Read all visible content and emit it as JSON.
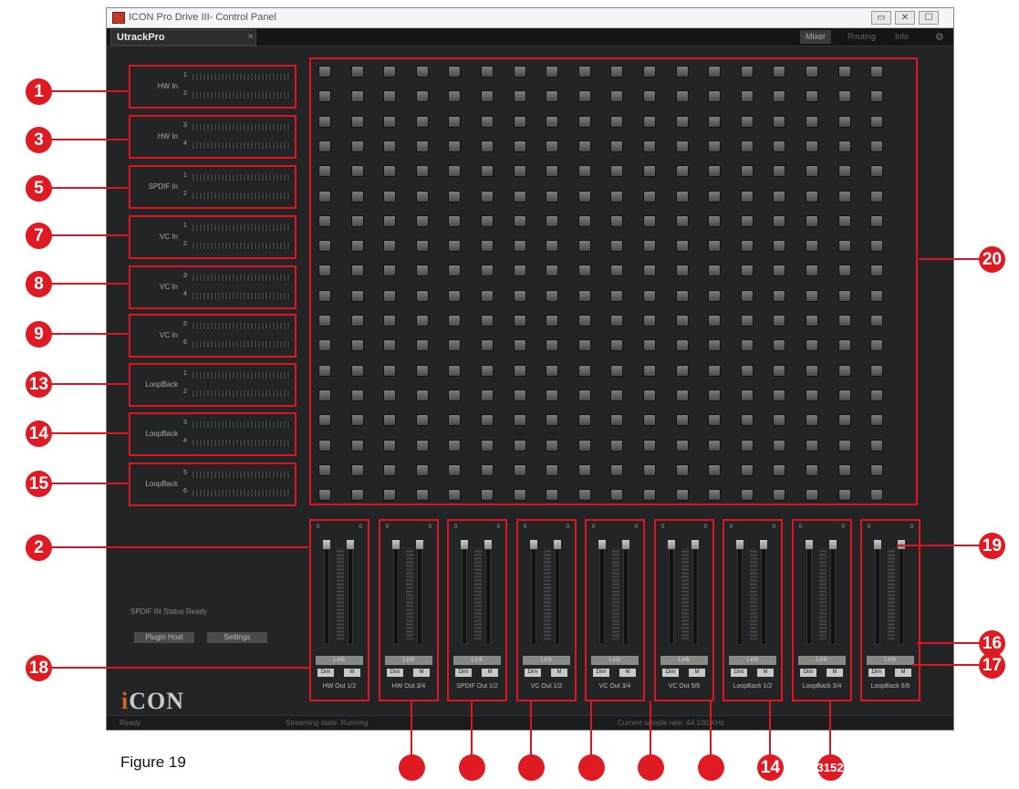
{
  "window": {
    "title": "ICON Pro Drive III- Control Panel",
    "device_tab": "UtrackPro",
    "nav_tabs": [
      "Mixer",
      "Routing",
      "Info"
    ],
    "active_nav": 0,
    "controls": [
      "▭",
      "✕",
      "☐"
    ],
    "gear": "⚙"
  },
  "inputs": [
    {
      "name": "HW In",
      "ch": [
        "1",
        "2"
      ]
    },
    {
      "name": "HW In",
      "ch": [
        "3",
        "4"
      ]
    },
    {
      "name": "SPDIF In",
      "ch": [
        "1",
        "2"
      ]
    },
    {
      "name": "VC In",
      "ch": [
        "1",
        "2"
      ]
    },
    {
      "name": "VC In",
      "ch": [
        "3",
        "4"
      ]
    },
    {
      "name": "VC In",
      "ch": [
        "5",
        "6"
      ]
    },
    {
      "name": "LoopBack",
      "ch": [
        "1",
        "2"
      ]
    },
    {
      "name": "LoopBack",
      "ch": [
        "3",
        "4"
      ]
    },
    {
      "name": "LoopBack",
      "ch": [
        "5",
        "6"
      ]
    }
  ],
  "matrix": {
    "rows": 18,
    "cols": 18
  },
  "outputs": [
    {
      "label": "HW Out 1/2",
      "link": "Link",
      "solo": "Dim",
      "mute": "M",
      "db_left": "0",
      "db_right": "0"
    },
    {
      "label": "HW Out 3/4",
      "link": "Link",
      "solo": "Dim",
      "mute": "M",
      "db_left": "0",
      "db_right": "0"
    },
    {
      "label": "SPDIF Out 1/2",
      "link": "Link",
      "solo": "Dim",
      "mute": "M",
      "db_left": "0",
      "db_right": "0"
    },
    {
      "label": "VC Out 1/2",
      "link": "Link",
      "solo": "Dim",
      "mute": "M",
      "db_left": "0",
      "db_right": "0"
    },
    {
      "label": "VC Out 3/4",
      "link": "Link",
      "solo": "Dim",
      "mute": "M",
      "db_left": "0",
      "db_right": "0"
    },
    {
      "label": "VC Out 5/6",
      "link": "Link",
      "solo": "Dim",
      "mute": "M",
      "db_left": "0",
      "db_right": "0"
    },
    {
      "label": "LoopBack 1/2",
      "link": "Link",
      "solo": "Dim",
      "mute": "M",
      "db_left": "0",
      "db_right": "0"
    },
    {
      "label": "LoopBack 3/4",
      "link": "Link",
      "solo": "Dim",
      "mute": "M",
      "db_left": "0",
      "db_right": "0"
    },
    {
      "label": "LoopBack 5/6",
      "link": "Link",
      "solo": "Dim",
      "mute": "M",
      "db_left": "0",
      "db_right": "0"
    }
  ],
  "spdif_status": "SPDIF IN Status Ready",
  "buttons": {
    "plugin_host": "Plugin Host",
    "settings": "Settings"
  },
  "logo": {
    "prefix": "i",
    "name": "CON"
  },
  "status": {
    "left": "Ready",
    "mid": "Streaming state: Running",
    "right": "Current sample rate: 44,100 KHz"
  },
  "callouts": {
    "left": [
      "1",
      "3",
      "5",
      "7",
      "8",
      "9",
      "13",
      "14",
      "15",
      "2",
      "18"
    ],
    "right": [
      "20",
      "19",
      "16",
      "17"
    ],
    "bottom": [
      "",
      "",
      "",
      "",
      "",
      "",
      "14",
      "3152"
    ]
  },
  "figure": "Figure 19",
  "colors": {
    "callout": "#e01a22",
    "window_bg": "#232426"
  }
}
